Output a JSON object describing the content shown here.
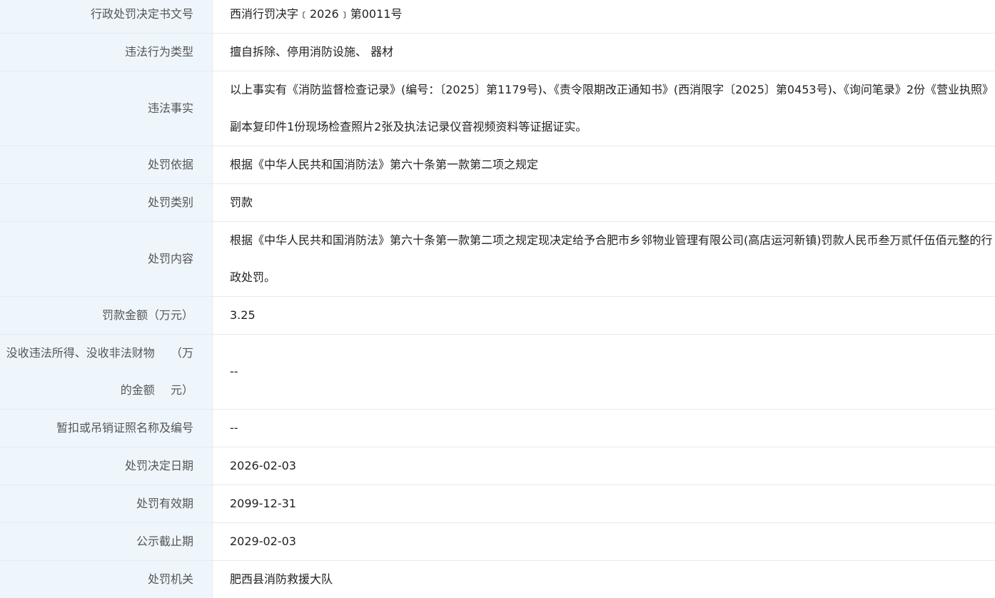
{
  "rows": [
    {
      "label": "行政处罚决定书文号",
      "value": "西消行罚决字﹝2026﹞第0011号"
    },
    {
      "label": "违法行为类型",
      "value": "擅自拆除、停用消防设施、 器材"
    },
    {
      "label": "违法事实",
      "value": "以上事实有《消防监督检查记录》(编号：〔2025〕第1179号)、《责令限期改正通知书》(西消限字〔2025〕第0453号)、《询问笔录》2份《营业执照》副本复印件1份现场检查照片2张及执法记录仪音视频资料等证据证实。"
    },
    {
      "label": "处罚依据",
      "value": "根据《中华人民共和国消防法》第六十条第一款第二项之规定"
    },
    {
      "label": "处罚类别",
      "value": "罚款"
    },
    {
      "label": "处罚内容",
      "value": "根据《中华人民共和国消防法》第六十条第一款第二项之规定现决定给予合肥市乡邻物业管理有限公司(高店运河新镇)罚款人民币叁万贰仟伍佰元整的行政处罚。"
    },
    {
      "label": "罚款金额（万元）",
      "value": "3.25"
    },
    {
      "label_line1": "没收违法所得、没收非法财物的金额",
      "label_line2": "（万元）",
      "value": "--"
    },
    {
      "label": "暂扣或吊销证照名称及编号",
      "value": "--"
    },
    {
      "label": "处罚决定日期",
      "value": "2026-02-03"
    },
    {
      "label": "处罚有效期",
      "value": "2099-12-31"
    },
    {
      "label": "公示截止期",
      "value": "2029-02-03"
    },
    {
      "label": "处罚机关",
      "value": "肥西县消防救援大队"
    }
  ]
}
